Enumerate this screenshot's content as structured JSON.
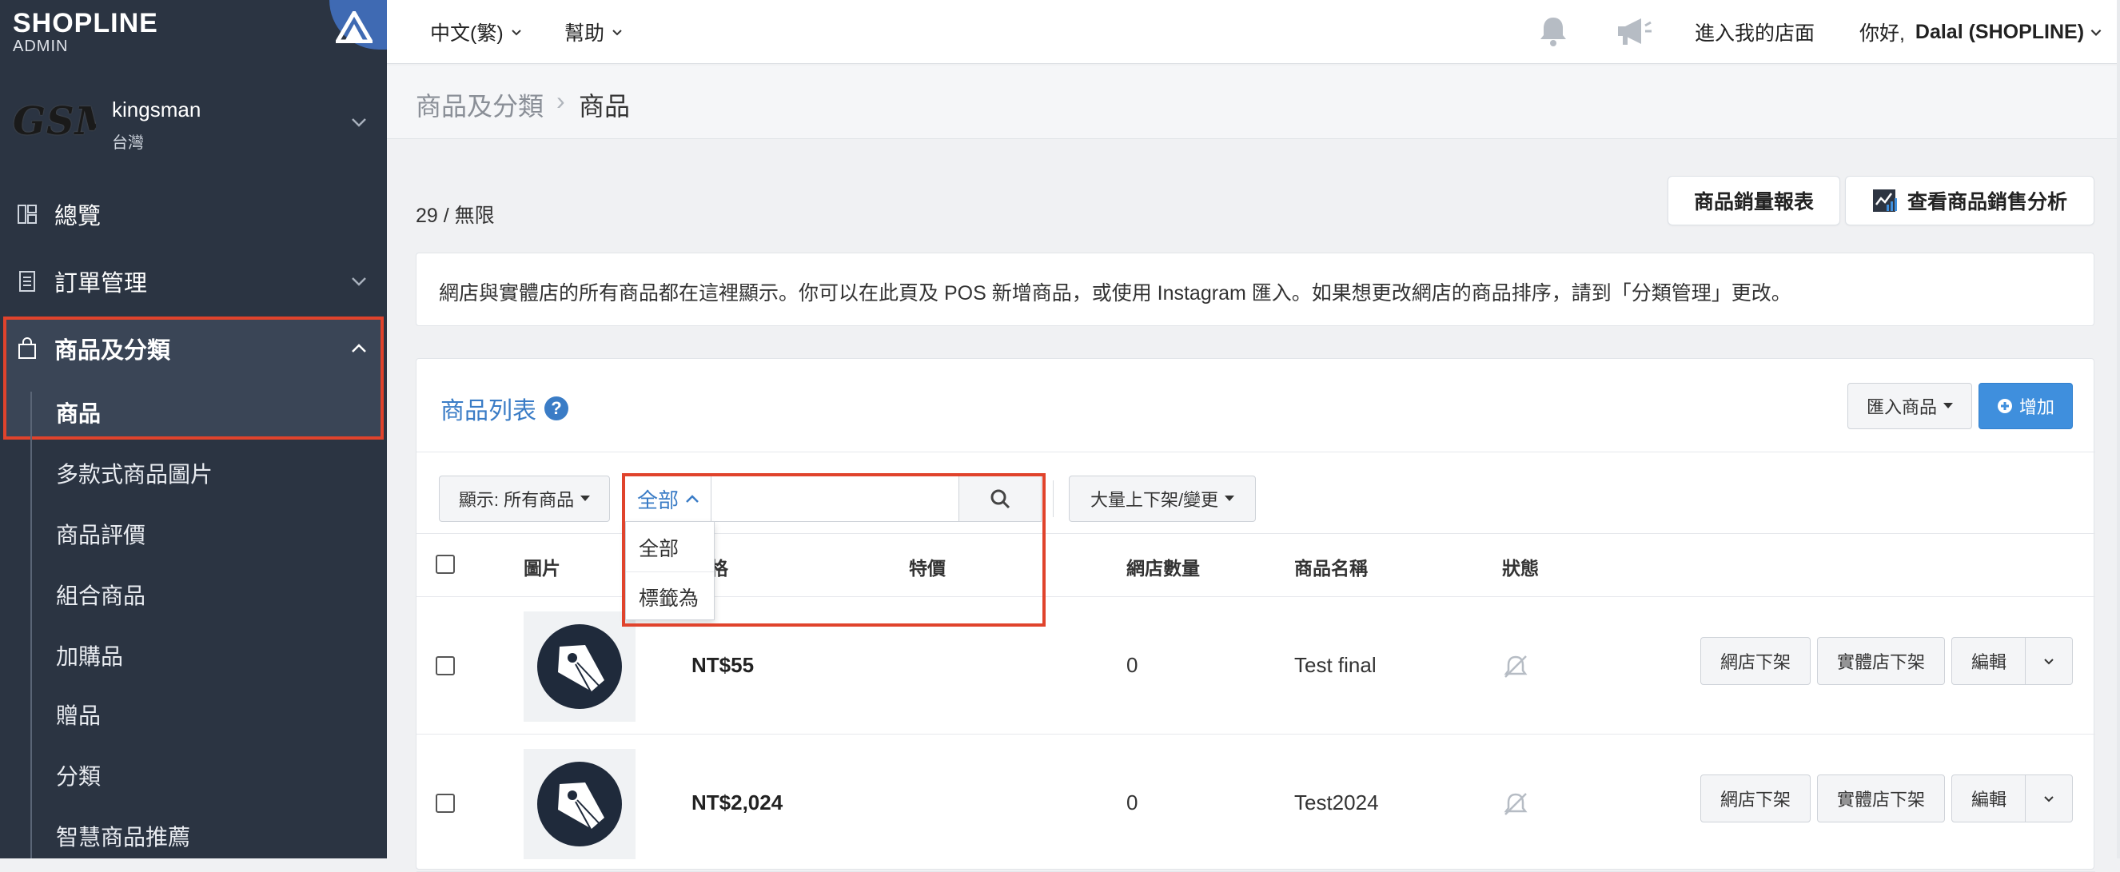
{
  "brand": {
    "name": "SHOPLINE",
    "sub": "ADMIN"
  },
  "store": {
    "logo_text": "GSM",
    "name": "kingsman",
    "region": "台灣"
  },
  "sidebar": {
    "items": [
      {
        "label": "總覽",
        "icon": "dashboard-icon"
      },
      {
        "label": "訂單管理",
        "icon": "order-icon"
      },
      {
        "label": "商品及分類",
        "icon": "shopping-bag-icon"
      }
    ],
    "subitems": [
      {
        "label": "商品"
      },
      {
        "label": "多款式商品圖片"
      },
      {
        "label": "商品評價"
      },
      {
        "label": "組合商品"
      },
      {
        "label": "加購品"
      },
      {
        "label": "贈品"
      },
      {
        "label": "分類"
      },
      {
        "label": "智慧商品推薦"
      }
    ]
  },
  "topbar": {
    "language": "中文(繁)",
    "help": "幫助",
    "storefront_link": "進入我的店面",
    "greeting_prefix": "你好, ",
    "user": "Dalal (SHOPLINE)"
  },
  "breadcrumb": {
    "parent": "商品及分類",
    "separator": "›",
    "current": "商品"
  },
  "page": {
    "count": "29 / 無限",
    "sales_report_label": "商品銷量報表",
    "sales_analysis_label": "查看商品銷售分析",
    "notice": "網店與實體店的所有商品都在這裡顯示。你可以在此頁及 POS 新增商品，或使用 Instagram 匯入。如果想更改網店的商品排序，請到「分類管理」更改。"
  },
  "panel": {
    "title": "商品列表",
    "help_glyph": "?",
    "import_label": "匯入商品",
    "add_label": "增加",
    "filter_label": "顯示: 所有商品",
    "scope_label": "全部",
    "search_placeholder": "",
    "bulk_label": "大量上下架/變更",
    "dropdown_options": [
      "全部",
      "標籤為"
    ]
  },
  "table": {
    "headers": {
      "image": "圖片",
      "price": "價格",
      "sale_price": "特價",
      "online_qty": "網店數量",
      "name": "商品名稱",
      "status": "狀態"
    },
    "rows": [
      {
        "price": "NT$55",
        "sale_price": "",
        "online_qty": "0",
        "name": "Test final"
      },
      {
        "price": "NT$2,024",
        "sale_price": "",
        "online_qty": "0",
        "name": "Test2024"
      }
    ],
    "row_actions": {
      "online_unpublish": "網店下架",
      "retail_unpublish": "實體店下架",
      "edit": "編輯"
    }
  },
  "colors": {
    "sidebar": "#2b3442",
    "accent_blue": "#3f8fdd",
    "link_blue": "#3a7cc6",
    "highlight_red": "#e0432c"
  }
}
